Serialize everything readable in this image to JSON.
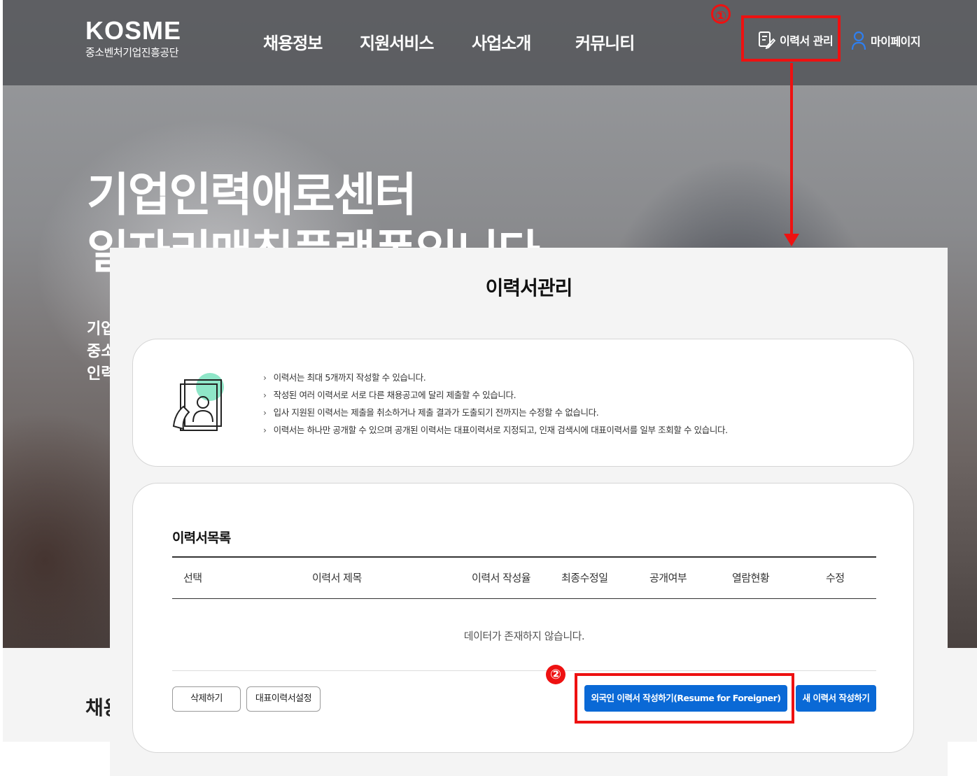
{
  "site": {
    "logo_main": "KOSME",
    "logo_sub": "중소벤처기업진흥공단"
  },
  "nav": [
    "채용정보",
    "지원서비스",
    "사업소개",
    "커뮤니티"
  ],
  "utility": {
    "resume_manage": "이력서 관리",
    "mypage": "마이페이지"
  },
  "hero": {
    "title_line1": "기업인력애로센터",
    "title_line2": "일자리매칭플랫폼입니다",
    "sub_lines": [
      "기업",
      "중소",
      "인력"
    ]
  },
  "bottom_title": "채용",
  "annotations": {
    "step1": "①",
    "step2": "②",
    "color": "#ee1111"
  },
  "panel": {
    "title": "이력서관리",
    "info": [
      "이력서는 최대 5개까지 작성할 수 있습니다.",
      "작성된 여러 이력서로 서로 다른 채용공고에 달리 제출할 수 있습니다.",
      "입사 지원된 이력서는 제출을 취소하거나 제출 결과가 도출되기 전까지는 수정할 수 없습니다.",
      "이력서는 하나만 공개할 수 있으며 공개된 이력서는 대표이력서로 지정되고, 인재 검색시에 대표이력서를 일부 조회할 수 있습니다."
    ],
    "list_title": "이력서목록",
    "columns": [
      "선택",
      "이력서 제목",
      "이력서 작성율",
      "최종수정일",
      "공개여부",
      "열람현황",
      "수정"
    ],
    "empty_message": "데이터가 존재하지 않습니다.",
    "buttons": {
      "delete": "삭제하기",
      "set_representative": "대표이력서설정",
      "foreigner_resume": "외국인 이력서 작성하기(Resume for Foreigner)",
      "new_resume": "새 이력서 작성하기"
    },
    "accent": "#0a69d6"
  }
}
